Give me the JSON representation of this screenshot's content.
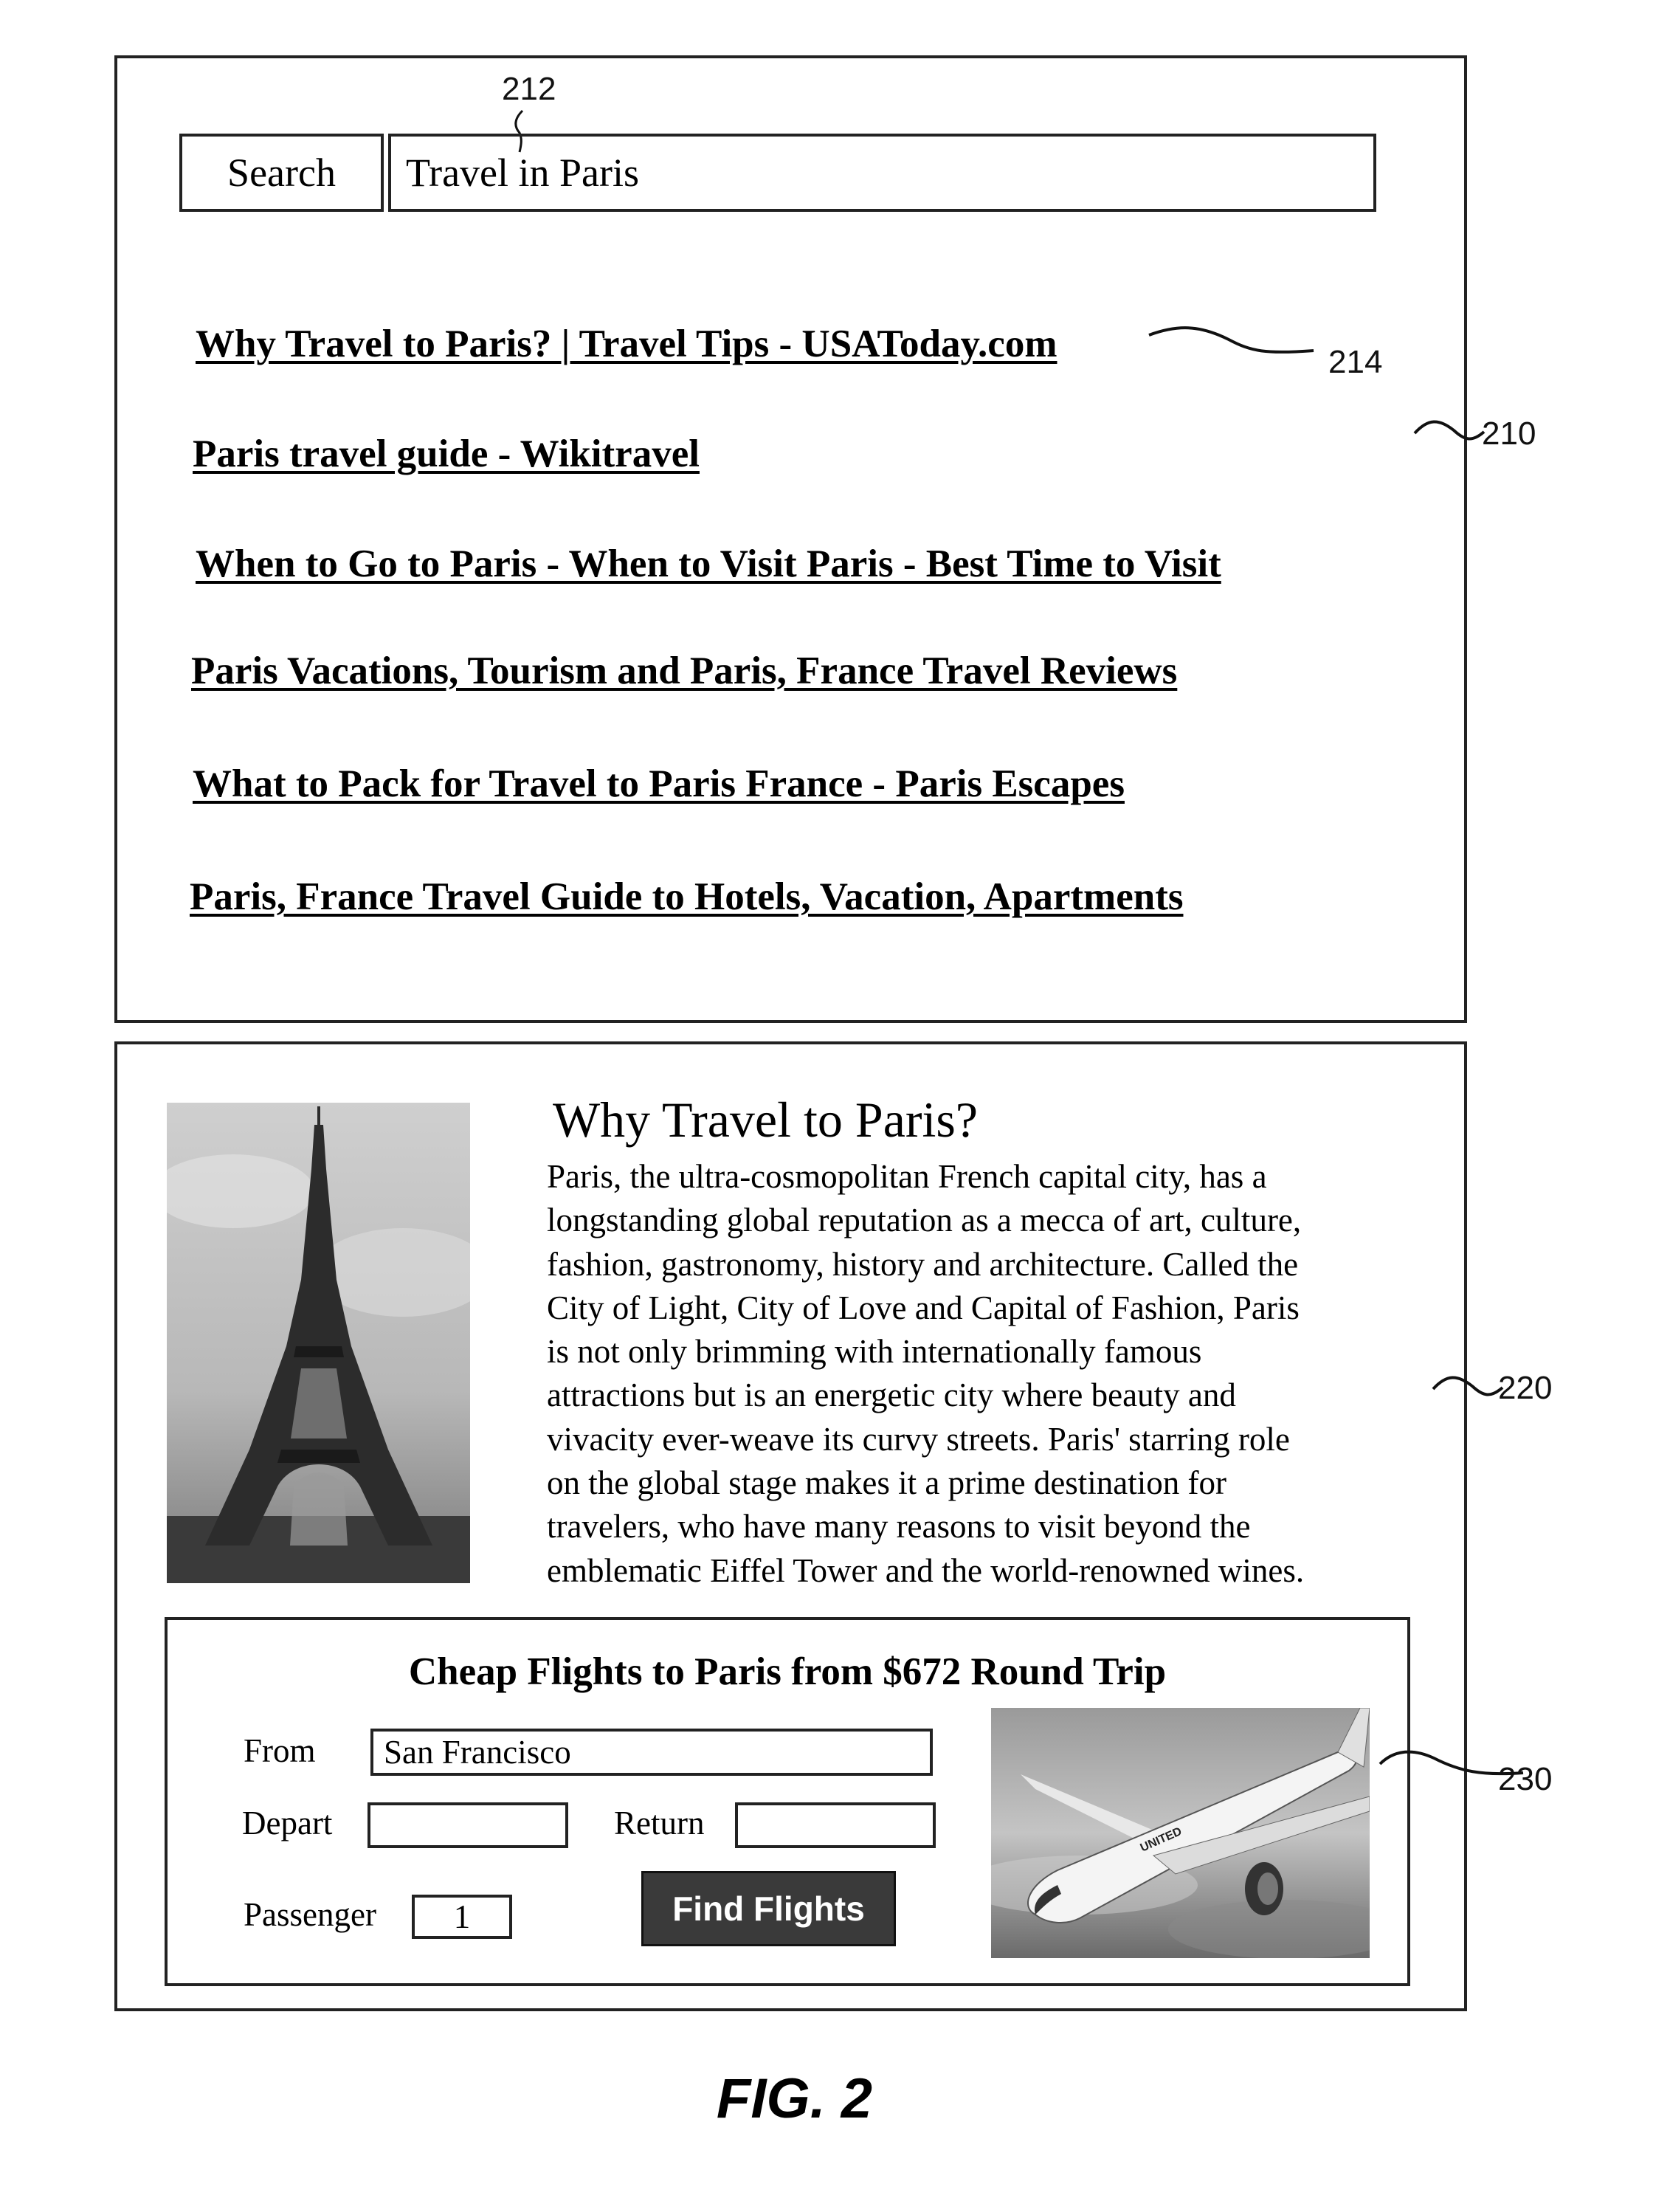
{
  "search_panel": {
    "ref": "210",
    "search_button_label": "Search",
    "search_input_value": "Travel in Paris",
    "search_input_ref": "212",
    "results_ref": "214",
    "results": [
      "Why Travel to Paris? | Travel Tips - USAToday.com",
      "Paris travel guide - Wikitravel",
      "When to Go to Paris - When to Visit Paris - Best Time to Visit",
      "Paris Vacations, Tourism and Paris, France Travel Reviews",
      "What to Pack for Travel to Paris France - Paris Escapes",
      "Paris, France Travel Guide to Hotels, Vacation, Apartments"
    ]
  },
  "article_panel": {
    "ref": "220",
    "image_icon": "eiffel-tower-photo",
    "title": "Why Travel to Paris?",
    "body_lines": [
      "Paris, the ultra-cosmopolitan French capital city, has a",
      "longstanding global reputation as a mecca of art, culture,",
      "fashion, gastronomy, history and architecture. Called the",
      "City of Light, City of Love and Capital of Fashion, Paris",
      "is not only brimming with internationally famous",
      "attractions but is an energetic city where beauty and",
      "vivacity ever-weave its curvy streets. Paris' starring role",
      "on the global stage makes it a prime destination for",
      "travelers, who have many reasons to visit beyond the",
      "emblematic Eiffel Tower and the world-renowned wines."
    ]
  },
  "flights_widget": {
    "ref": "230",
    "title": "Cheap Flights to Paris from $672 Round Trip",
    "from_label": "From",
    "from_value": "San Francisco",
    "depart_label": "Depart",
    "depart_value": "",
    "return_label": "Return",
    "return_value": "",
    "passenger_label": "Passenger",
    "passenger_value": "1",
    "find_button_label": "Find Flights",
    "image_icon": "airplane-photo",
    "airline_text": "UNITED"
  },
  "caption": "FIG. 2"
}
